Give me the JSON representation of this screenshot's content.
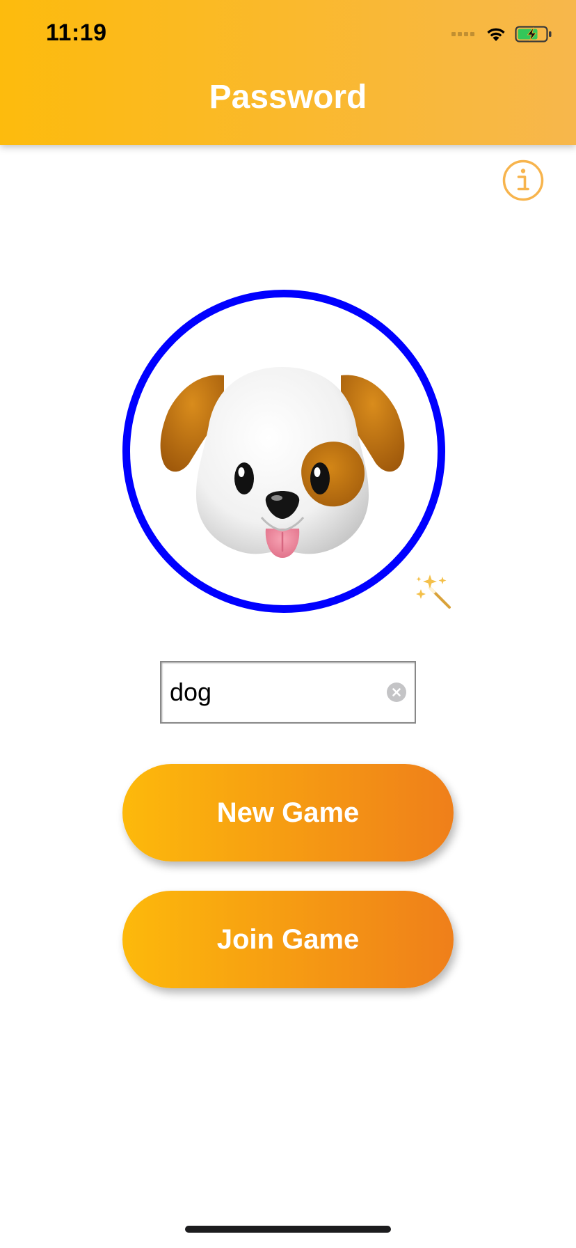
{
  "status_bar": {
    "time": "11:19"
  },
  "header": {
    "title": "Password",
    "gradient_start": "#fdbb0d",
    "gradient_end": "#f7b74c"
  },
  "info_button": {
    "icon": "info-icon",
    "color": "#f7b44d"
  },
  "avatar": {
    "icon": "dog-face-icon",
    "ring_color": "#0000ff"
  },
  "magic_button": {
    "icon": "magic-wand-icon"
  },
  "name_field": {
    "value": "dog"
  },
  "buttons": {
    "new_game": "New Game",
    "join_game": "Join Game",
    "gradient_start": "#fdb90b",
    "gradient_end": "#ef7f1a"
  }
}
